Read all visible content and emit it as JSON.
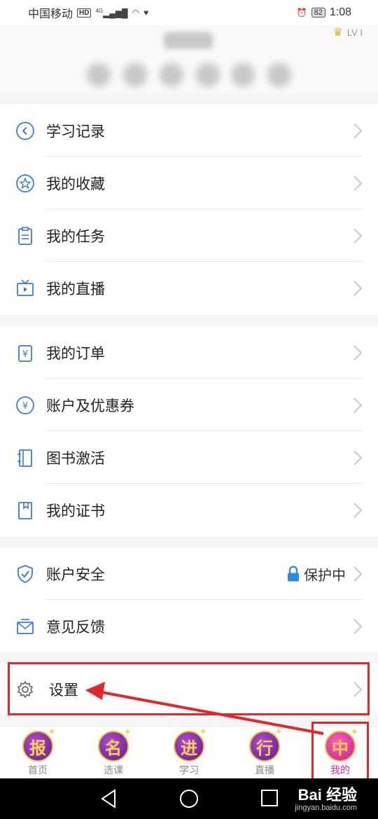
{
  "status_bar": {
    "carrier": "中国移动",
    "network": "HD",
    "signal_label": "4G",
    "battery": "82",
    "time": "1:08"
  },
  "header": {
    "level": "LV I"
  },
  "groups": [
    [
      {
        "icon": "chevron-left-circle-icon",
        "label": "学习记录"
      },
      {
        "icon": "star-circle-icon",
        "label": "我的收藏"
      },
      {
        "icon": "clipboard-icon",
        "label": "我的任务"
      },
      {
        "icon": "tv-play-icon",
        "label": "我的直播"
      }
    ],
    [
      {
        "icon": "order-receipt-icon",
        "label": "我的订单"
      },
      {
        "icon": "yen-coin-icon",
        "label": "账户及优惠券"
      },
      {
        "icon": "book-icon",
        "label": "图书激活"
      },
      {
        "icon": "certificate-icon",
        "label": "我的证书"
      }
    ],
    [
      {
        "icon": "shield-check-icon",
        "label": "账户安全",
        "status": "保护中",
        "status_icon": "lock-icon"
      },
      {
        "icon": "feedback-mail-icon",
        "label": "意见反馈"
      }
    ],
    [
      {
        "icon": "gear-icon",
        "label": "设置"
      }
    ]
  ],
  "tabs": [
    {
      "glyph": "报",
      "label": "首页",
      "active": false
    },
    {
      "glyph": "名",
      "label": "选课",
      "active": false
    },
    {
      "glyph": "进",
      "label": "学习",
      "active": false
    },
    {
      "glyph": "行",
      "label": "直播",
      "active": false
    },
    {
      "glyph": "中",
      "label": "我的",
      "active": true
    }
  ],
  "watermark": {
    "brand": "Bai 经验",
    "url": "jingyan.baidu.com"
  },
  "colors": {
    "highlight": "#e0282a",
    "icon_blue": "#3b7bd6",
    "tab_active": "#d32d9a",
    "lock_blue": "#2a8ae6"
  }
}
